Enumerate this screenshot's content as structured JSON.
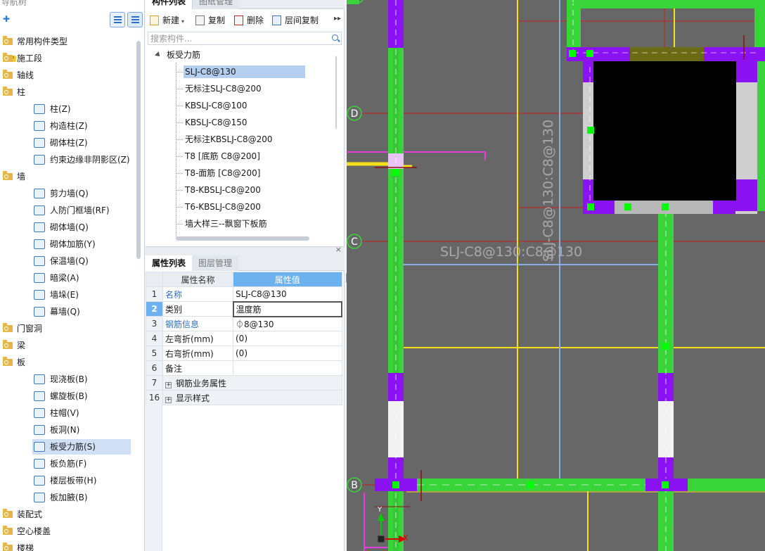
{
  "nav": {
    "title": "导航树",
    "items": [
      {
        "label": "常用构件类型",
        "type": "folder"
      },
      {
        "label": "施工段",
        "type": "folder",
        "badge": "VIP"
      },
      {
        "label": "轴线",
        "type": "folder"
      },
      {
        "label": "柱",
        "type": "folder"
      },
      {
        "label": "柱(Z)",
        "type": "child",
        "icon": "column-icon"
      },
      {
        "label": "构造柱(Z)",
        "type": "child",
        "icon": "construct-column-icon"
      },
      {
        "label": "砌体柱(Z)",
        "type": "child",
        "icon": "masonry-column-icon"
      },
      {
        "label": "约束边缘非阴影区(Z)",
        "type": "child",
        "icon": "boundary-zone-icon"
      },
      {
        "label": "墙",
        "type": "folder"
      },
      {
        "label": "剪力墙(Q)",
        "type": "child",
        "icon": "shear-wall-icon"
      },
      {
        "label": "人防门框墙(RF)",
        "type": "child",
        "icon": "door-frame-wall-icon"
      },
      {
        "label": "砌体墙(Q)",
        "type": "child",
        "icon": "masonry-wall-icon"
      },
      {
        "label": "砌体加筋(Y)",
        "type": "child",
        "icon": "masonry-rebar-icon"
      },
      {
        "label": "保温墙(Q)",
        "type": "child",
        "icon": "insulation-wall-icon"
      },
      {
        "label": "暗梁(A)",
        "type": "child",
        "icon": "hidden-beam-icon"
      },
      {
        "label": "墙垛(E)",
        "type": "child",
        "icon": "wall-pier-icon"
      },
      {
        "label": "幕墙(Q)",
        "type": "child",
        "icon": "curtain-wall-icon"
      },
      {
        "label": "门窗洞",
        "type": "folder"
      },
      {
        "label": "梁",
        "type": "folder"
      },
      {
        "label": "板",
        "type": "folder"
      },
      {
        "label": "现浇板(B)",
        "type": "child",
        "icon": "cast-slab-icon"
      },
      {
        "label": "螺旋板(B)",
        "type": "child",
        "icon": "spiral-slab-icon"
      },
      {
        "label": "柱帽(V)",
        "type": "child",
        "icon": "column-cap-icon"
      },
      {
        "label": "板洞(N)",
        "type": "child",
        "icon": "slab-hole-icon"
      },
      {
        "label": "板受力筋(S)",
        "type": "child",
        "icon": "slab-rebar-icon",
        "selected": true
      },
      {
        "label": "板负筋(F)",
        "type": "child",
        "icon": "slab-neg-rebar-icon"
      },
      {
        "label": "楼层板带(H)",
        "type": "child",
        "icon": "slab-strip-icon"
      },
      {
        "label": "板加腋(B)",
        "type": "child",
        "icon": "slab-haunch-icon"
      },
      {
        "label": "装配式",
        "type": "folder"
      },
      {
        "label": "空心楼盖",
        "type": "folder"
      },
      {
        "label": "楼梯",
        "type": "folder"
      }
    ]
  },
  "component_panel": {
    "tabs": [
      "构件列表",
      "图纸管理"
    ],
    "toolbar": {
      "new": "新建",
      "copy": "复制",
      "delete": "删除",
      "floor_copy": "层间复制"
    },
    "search_placeholder": "搜索构件...",
    "group": "板受力筋",
    "items": [
      {
        "label": "SLJ-C8@130",
        "selected": true
      },
      {
        "label": "无标注SLJ-C8@200"
      },
      {
        "label": "KBSLJ-C8@100"
      },
      {
        "label": "KBSLJ-C8@150"
      },
      {
        "label": "无标注KBSLJ-C8@200"
      },
      {
        "label": "T8 [底筋 C8@200]"
      },
      {
        "label": "T8-面筋 [C8@200]"
      },
      {
        "label": "T8-KBSLJ-C8@200"
      },
      {
        "label": "T6-KBSLJ-C8@200"
      },
      {
        "label": "墙大样三--飘窗下板筋"
      }
    ]
  },
  "property_panel": {
    "tabs": [
      "属性列表",
      "图层管理"
    ],
    "headers": {
      "name": "属性名称",
      "value": "属性值"
    },
    "rows": [
      {
        "no": "1",
        "name": "名称",
        "value": "SLJ-C8@130",
        "link": true
      },
      {
        "no": "2",
        "name": "类别",
        "value": "温度筋",
        "selected": true
      },
      {
        "no": "3",
        "name": "钢筋信息",
        "value": "⏀8@130",
        "link": true
      },
      {
        "no": "4",
        "name": "左弯折(mm)",
        "value": "(0)"
      },
      {
        "no": "5",
        "name": "右弯折(mm)",
        "value": "(0)"
      },
      {
        "no": "6",
        "name": "备注",
        "value": ""
      },
      {
        "no": "7",
        "name": "钢筋业务属性",
        "value": "",
        "expandable": true
      },
      {
        "no": "16",
        "name": "显示样式",
        "value": "",
        "expandable": true
      }
    ]
  },
  "canvas": {
    "axis_labels": [
      "D",
      "C",
      "B"
    ],
    "rebar_label_h": "SLJ-C8@130:C8@130",
    "rebar_label_v": "SLJ-C8@130:C8@130",
    "ucs": {
      "x": "X",
      "y": "Y"
    },
    "colors": {
      "background": "#676767",
      "wall_green": "#39d33a",
      "wall_purple": "#8b12f2",
      "axis_red": "#c81e1e",
      "yellow": "#f5e01a",
      "rebar_blue": "#88aee3",
      "magenta": "#e83ee0"
    }
  }
}
